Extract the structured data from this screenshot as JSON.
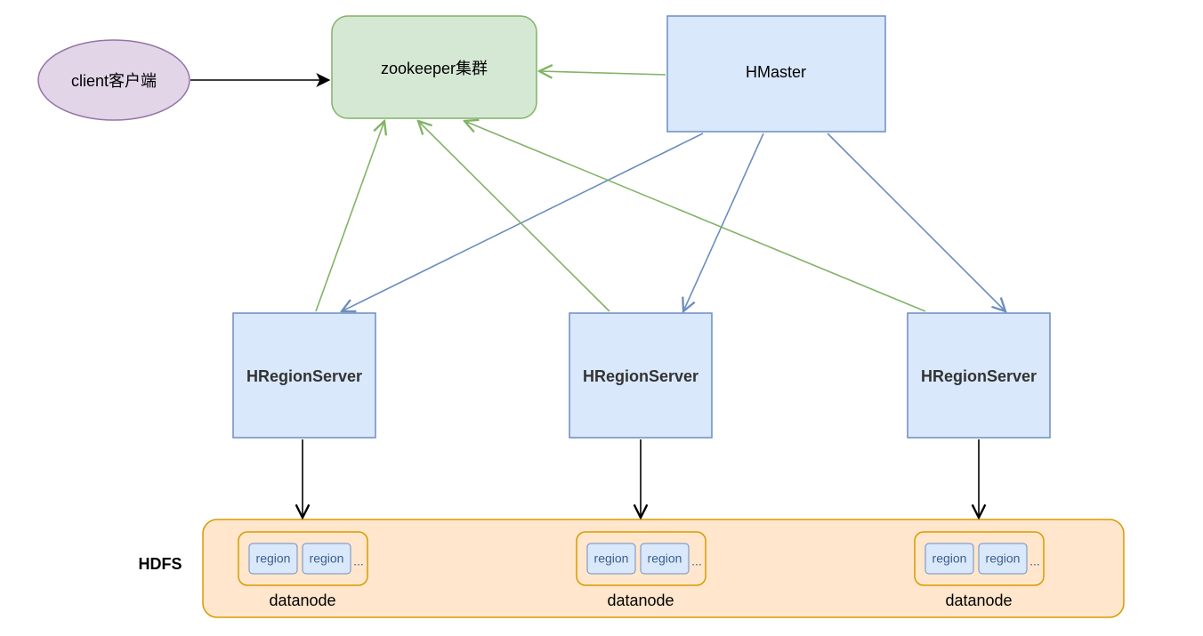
{
  "nodes": {
    "client": {
      "label": "client客户端"
    },
    "zookeeper": {
      "label": "zookeeper集群"
    },
    "hmaster": {
      "label": "HMaster"
    },
    "hrs1": {
      "label": "HRegionServer"
    },
    "hrs2": {
      "label": "HRegionServer"
    },
    "hrs3": {
      "label": "HRegionServer"
    }
  },
  "hdfs": {
    "label": "HDFS",
    "datanodes": [
      {
        "label": "datanode",
        "regions": [
          "region",
          "region"
        ],
        "ellipsis": "..."
      },
      {
        "label": "datanode",
        "regions": [
          "region",
          "region"
        ],
        "ellipsis": "..."
      },
      {
        "label": "datanode",
        "regions": [
          "region",
          "region"
        ],
        "ellipsis": "..."
      }
    ]
  },
  "colors": {
    "purpleFill": "#e1d5e7",
    "purpleStroke": "#9673a6",
    "greenFill": "#d5e8d4",
    "greenStroke": "#82b366",
    "blueFill": "#dae8fc",
    "blueStroke": "#6c8ebf",
    "orangeFill": "#ffe6cc",
    "orangeStroke": "#d79b00",
    "black": "#000000",
    "arrowBlue": "#6c8ebf",
    "arrowGreen": "#82b366"
  }
}
